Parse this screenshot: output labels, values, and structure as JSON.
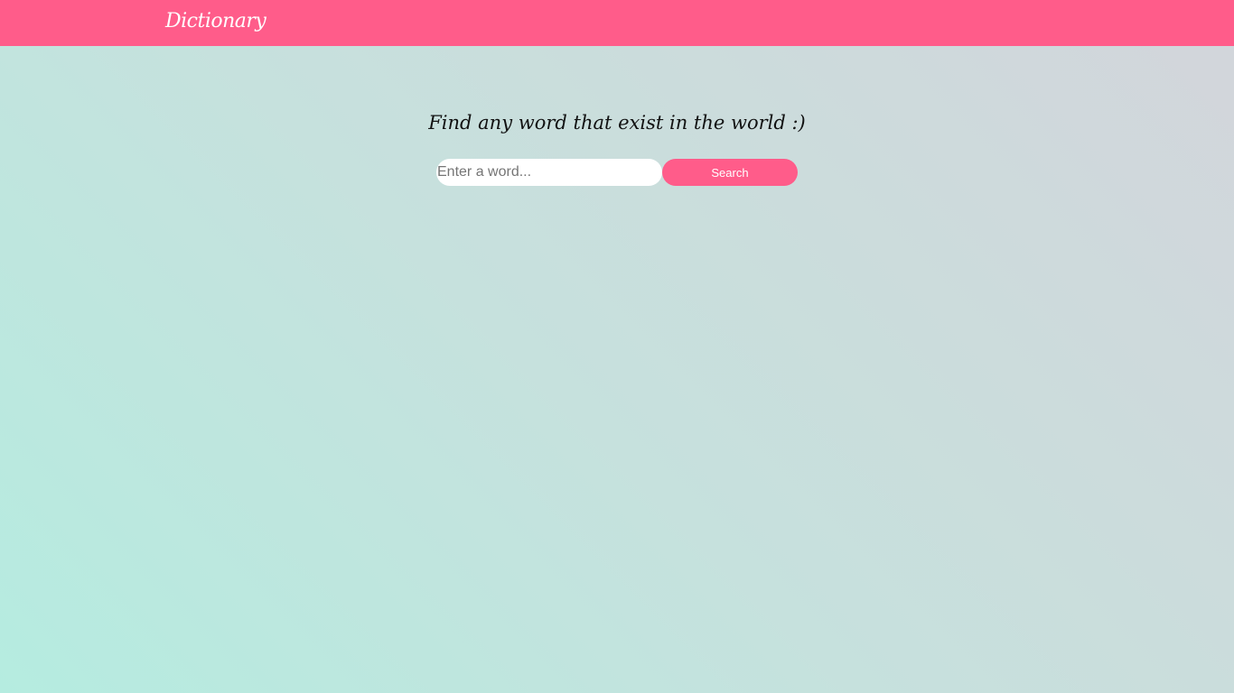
{
  "navbar": {
    "brand": "Dictionary",
    "background_color": "#ff5c8a"
  },
  "main": {
    "headline": "Find any word that exist in the world :)",
    "search": {
      "placeholder": "Enter a word...",
      "value": "",
      "button_label": "Search"
    }
  },
  "colors": {
    "accent": "#ff5c8a",
    "gradient_start": "#b5ece0",
    "gradient_end": "#d3d5db"
  }
}
